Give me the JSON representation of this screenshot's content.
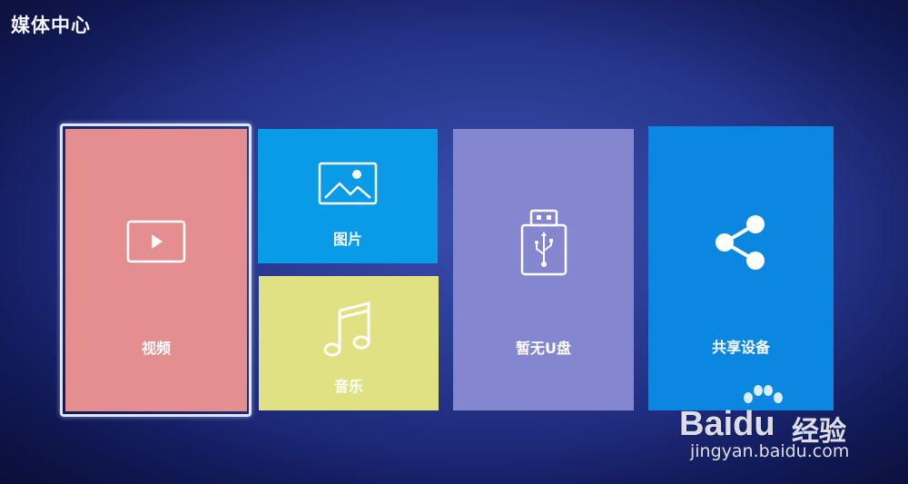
{
  "header": {
    "title": "媒体中心"
  },
  "tiles": {
    "video": {
      "label": "视频",
      "icon": "play-icon",
      "color": "#e48e90"
    },
    "pictures": {
      "label": "图片",
      "icon": "image-icon",
      "color": "#0a9be8"
    },
    "music": {
      "label": "音乐",
      "icon": "music-note-icon",
      "color": "#dfe183"
    },
    "usb": {
      "label": "暂无U盘",
      "icon": "usb-icon",
      "color": "#8486cf"
    },
    "share": {
      "label": "共享设备",
      "icon": "share-icon",
      "color": "#0b87e1"
    }
  },
  "watermark": {
    "logo": "Bai",
    "logo_du": "du",
    "text": "经验",
    "url": "jingyan.baidu.com"
  }
}
